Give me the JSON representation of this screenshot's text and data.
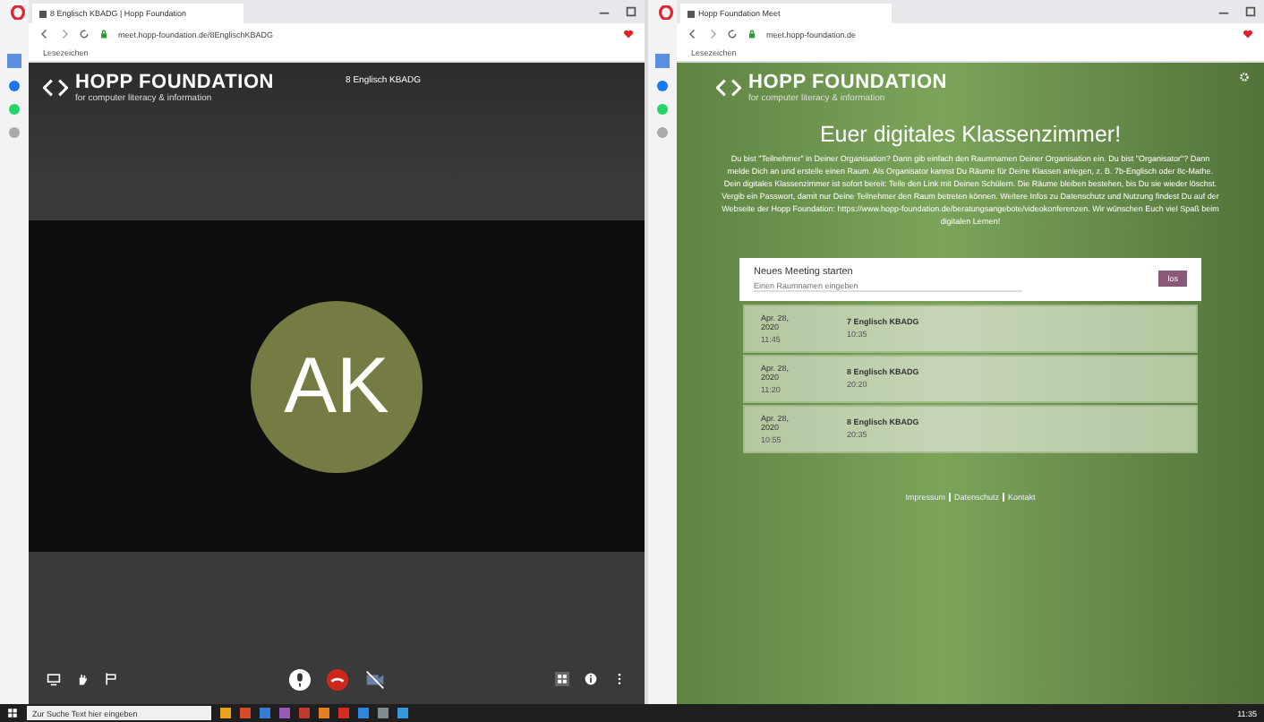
{
  "left_window": {
    "tab_title": "8 Englisch KBADG | Hopp Foundation",
    "url": "meet.hopp-foundation.de/8EnglischKBADG",
    "bookmark": "Lesezeichen",
    "page": {
      "logo_title": "HOPP FOUNDATION",
      "logo_subtitle": "for computer literacy & information",
      "meeting_title": "8 Englisch KBADG",
      "avatar_initials": "AK"
    }
  },
  "right_window": {
    "tab_title": "Hopp Foundation Meet",
    "url": "meet.hopp-foundation.de",
    "bookmark": "Lesezeichen",
    "page": {
      "logo_title": "HOPP FOUNDATION",
      "logo_subtitle": "for computer literacy & information",
      "heading": "Euer digitales Klassenzimmer!",
      "intro": "Du bist \"Teilnehmer\" in Deiner Organisation? Dann gib einfach den Raumnamen Deiner Organisation ein. Du bist \"Organisator\"? Dann melde Dich an und erstelle einen Raum. Als Organisator kannst Du Räume für Deine Klassen anlegen, z. B. 7b-Englisch oder 8c-Mathe. Dein digitales Klassenzimmer ist sofort bereit: Teile den Link mit Deinen Schülern. Die Räume bleiben bestehen, bis Du sie wieder löschst. Vergib ein Passwort, damit nur Deine Teilnehmer den Raum betreten können. Weitere Infos zu Datenschutz und Nutzung findest Du auf der Webseite der Hopp Foundation: https://www.hopp-foundation.de/beratungsangebote/videokonferenzen. Wir wünschen Euch viel Spaß beim digitalen Lernen!",
      "new_meeting": {
        "title": "Neues Meeting starten",
        "placeholder": "Einen Raumnamen eingeben",
        "button": "los"
      },
      "meetings": [
        {
          "date": "Apr. 28, 2020",
          "time": "11:45",
          "name": "7 Englisch KBADG",
          "duration": "10:35"
        },
        {
          "date": "Apr. 28, 2020",
          "time": "11:20",
          "name": "8 Englisch KBADG",
          "duration": "20:20"
        },
        {
          "date": "Apr. 28, 2020",
          "time": "10:55",
          "name": "8 Englisch KBADG",
          "duration": "20:35"
        }
      ],
      "footer_links": [
        "Impressum",
        "Datenschutz",
        "Kontakt"
      ]
    }
  },
  "taskbar": {
    "search_placeholder": "Zur Suche Text hier eingeben",
    "time": "11:35"
  }
}
